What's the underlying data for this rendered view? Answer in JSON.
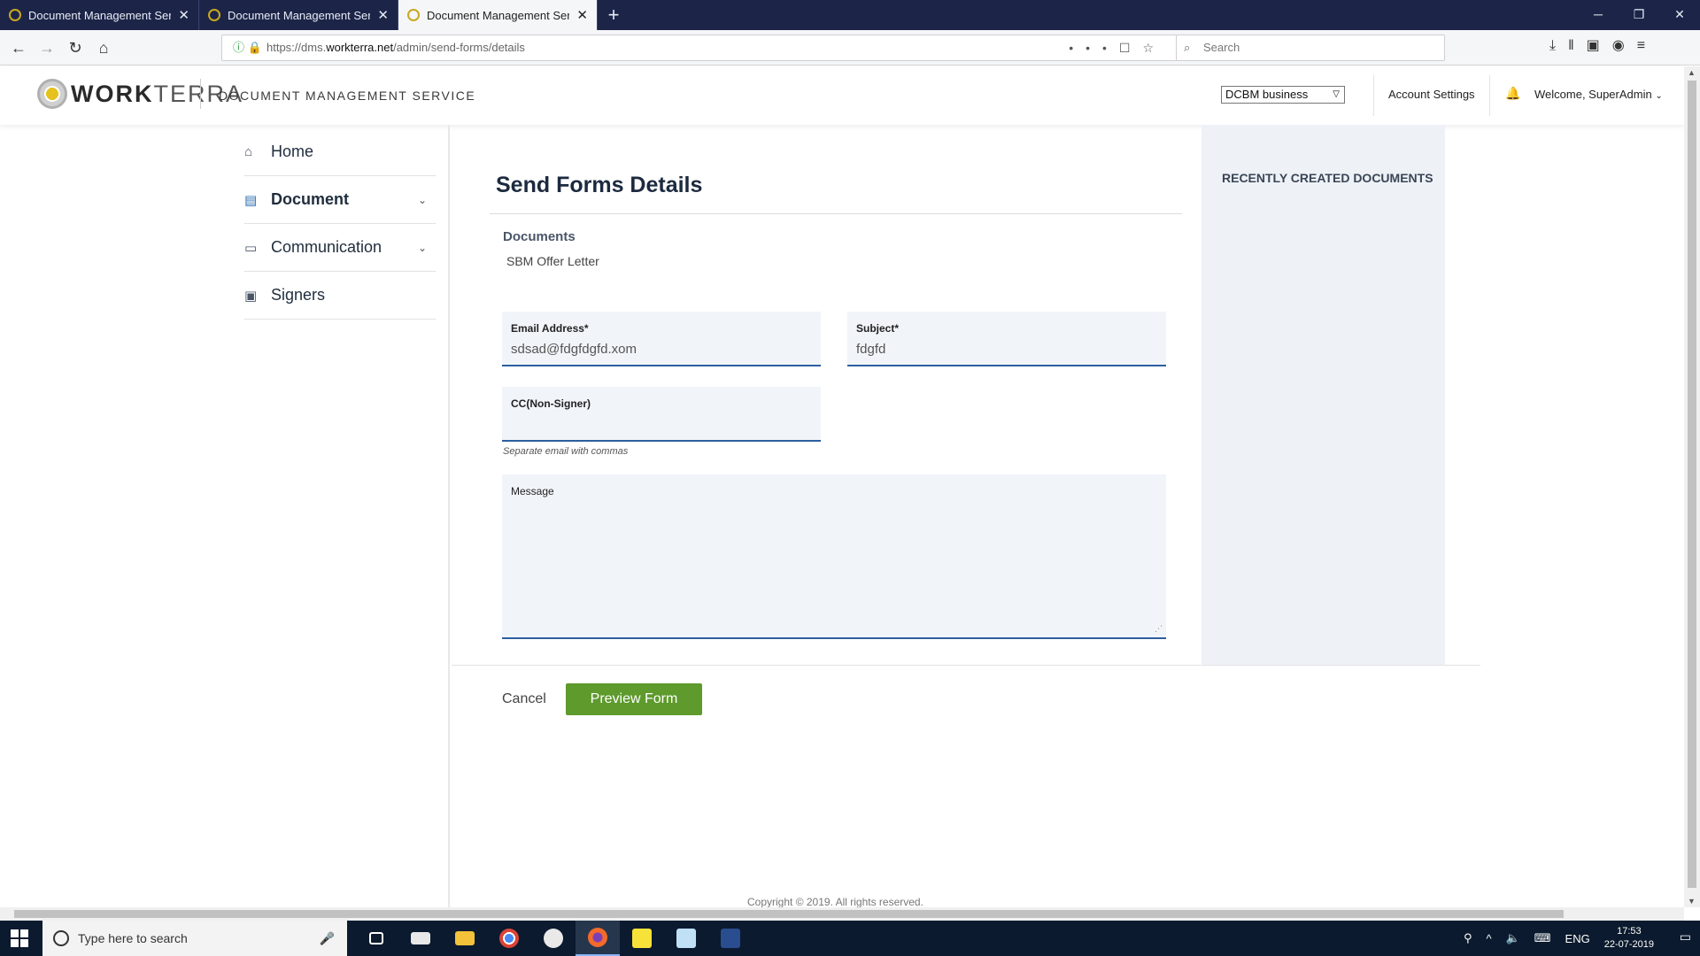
{
  "browser": {
    "tabs": [
      {
        "title": "Document Management Servic"
      },
      {
        "title": "Document Management Servic"
      },
      {
        "title": "Document Management Servic"
      }
    ],
    "url_prefix": "https://dms.",
    "url_host": "workterra.net",
    "url_path": "/admin/send-forms/details",
    "search_placeholder": "Search"
  },
  "header": {
    "logo_bold": "WORK",
    "logo_light": "TERRA",
    "app_name": "DOCUMENT MANAGEMENT SERVICE",
    "business_select": "DCBM business",
    "account_settings": "Account Settings",
    "welcome": "Welcome, SuperAdmin"
  },
  "sidebar": {
    "items": [
      {
        "label": "Home",
        "icon": "home-icon"
      },
      {
        "label": "Document",
        "icon": "document-icon"
      },
      {
        "label": "Communication",
        "icon": "chat-icon"
      },
      {
        "label": "Signers",
        "icon": "badge-icon"
      }
    ]
  },
  "main": {
    "title": "Send Forms Details",
    "documents_label": "Documents",
    "document_name": "SBM Offer Letter",
    "email_label": "Email Address*",
    "email_value": "sdsad@fdgfdgfd.xom",
    "subject_label": "Subject*",
    "subject_value": "fdgfd",
    "cc_label": "CC(Non-Signer)",
    "cc_value": "",
    "cc_hint": "Separate email with commas",
    "message_label": "Message",
    "message_value": "",
    "cancel": "Cancel",
    "preview": "Preview Form"
  },
  "recent": {
    "title": "RECENTLY CREATED DOCUMENTS"
  },
  "footer": {
    "copyright": "Copyright © 2019. All rights reserved."
  },
  "taskbar": {
    "search_placeholder": "Type here to search",
    "lang": "ENG",
    "time": "17:53",
    "date": "22-07-2019"
  },
  "colors": {
    "accent": "#2d5fa0",
    "button": "#5e9a2c",
    "tabbar": "#1c2548",
    "panel": "#eef2f7"
  }
}
